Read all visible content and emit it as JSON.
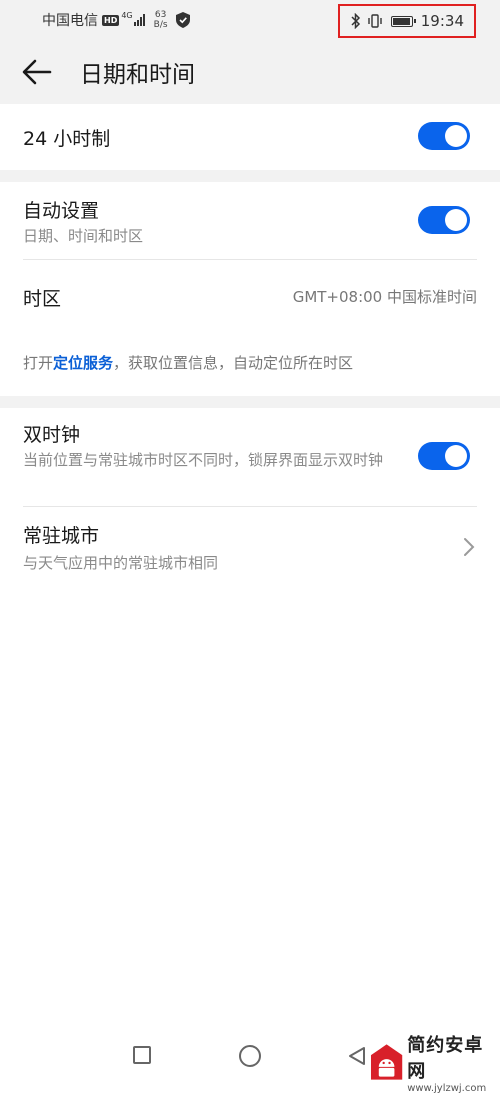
{
  "status_bar": {
    "carrier": "中国电信",
    "hd": "HD",
    "network": "4G",
    "speed_value": "63",
    "speed_unit": "B/s",
    "time": "19:34"
  },
  "header": {
    "title": "日期和时间"
  },
  "settings": {
    "hour24": {
      "label": "24 小时制",
      "enabled": true
    },
    "auto_set": {
      "label": "自动设置",
      "sub": "日期、时间和时区",
      "enabled": true
    },
    "timezone": {
      "label": "时区",
      "value": "GMT+08:00 中国标准时间"
    },
    "location_hint": {
      "prefix": "打开",
      "link": "定位服务",
      "suffix": "，获取位置信息，自动定位所在时区"
    },
    "dual_clock": {
      "label": "双时钟",
      "sub": "当前位置与常驻城市时区不同时，锁屏界面显示双时钟",
      "enabled": true
    },
    "home_city": {
      "label": "常驻城市",
      "sub": "与天气应用中的常驻城市相同"
    }
  },
  "watermark": {
    "title": "简约安卓网",
    "url": "www.jylzwj.com"
  },
  "colors": {
    "accent": "#0a64ec",
    "link": "#0a5fd6",
    "background_gray": "#f2f2f2",
    "highlight_box": "#e02020"
  }
}
